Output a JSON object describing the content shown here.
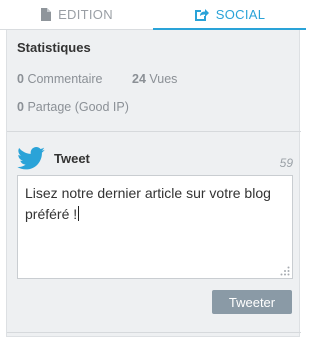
{
  "tabs": [
    {
      "label": "EDITION",
      "icon": "document-icon"
    },
    {
      "label": "SOCIAL",
      "icon": "share-icon",
      "active": true
    }
  ],
  "stats": {
    "title": "Statistiques",
    "comments_count": "0",
    "comments_label": "Commentaire",
    "views_count": "24",
    "views_label": "Vues",
    "shares_count": "0",
    "shares_label": "Partage (Good IP)"
  },
  "tweet": {
    "label": "Tweet",
    "remaining": "59",
    "text": "Lisez notre dernier article sur votre blog préféré !",
    "button_label": "Tweeter"
  },
  "colors": {
    "accent": "#2aa3d8",
    "panel_bg": "#eef0f2",
    "button_bg": "#8a9aa6",
    "muted_text": "#8b9096"
  }
}
